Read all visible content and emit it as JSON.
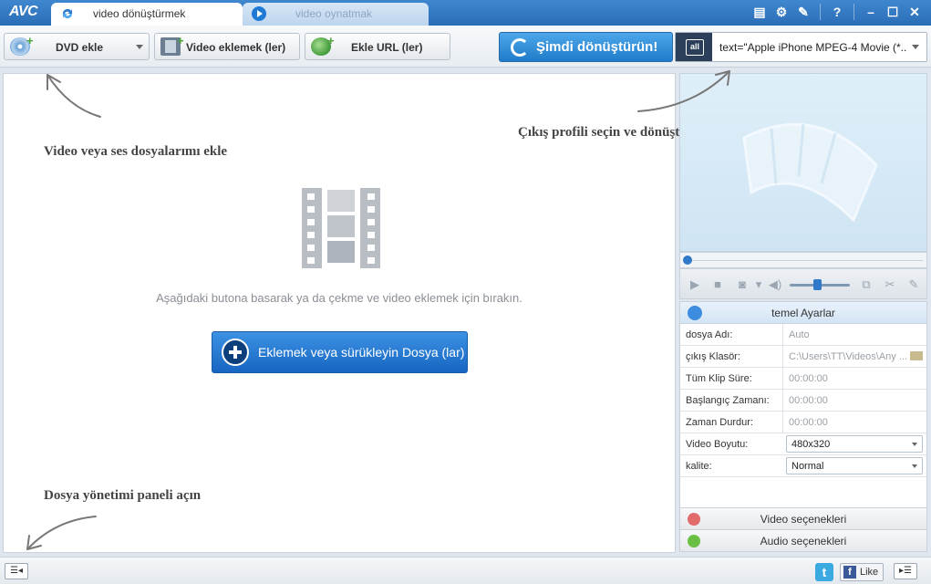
{
  "app": {
    "logo": "AVC"
  },
  "tabs": [
    {
      "label": "video dönüştürmek",
      "active": true
    },
    {
      "label": "video oynatmak",
      "active": false
    }
  ],
  "window_buttons": [
    "list-icon",
    "gear-icon",
    "wrench-icon",
    "help-icon",
    "minimize-icon",
    "maximize-icon",
    "close-icon"
  ],
  "toolbar": {
    "dvd_label": "DVD ekle",
    "video_label": "Video eklemek (ler)",
    "url_label": "Ekle URL (ler)",
    "convert_label": "Şimdi dönüştürün!",
    "profile_value": "text=\"Apple iPhone MPEG-4 Movie (*..."
  },
  "hints": {
    "add_files": "Video veya ses dosyalarımı ekle",
    "profile": "Çıkış profili seçin ve dönüştürmek",
    "file_panel": "Dosya yönetimi paneli açın"
  },
  "droparea": {
    "instruction": "Aşağıdaki butona basarak ya da çekme ve video eklemek için bırakın.",
    "add_button": "Eklemek veya sürükleyin Dosya (lar)"
  },
  "settings": {
    "header": "temel Ayarlar",
    "rows": [
      {
        "label": "dosya Adı:",
        "value": "Auto"
      },
      {
        "label": "çıkış Klasör:",
        "value": "C:\\Users\\TT\\Videos\\Any ..."
      },
      {
        "label": "Tüm Klip Süre:",
        "value": "00:00:00"
      },
      {
        "label": "Başlangıç Zamanı:",
        "value": "00:00:00"
      },
      {
        "label": "Zaman Durdur:",
        "value": "00:00:00"
      },
      {
        "label": "Video Boyutu:",
        "value": "480x320"
      },
      {
        "label": "kalite:",
        "value": "Normal"
      }
    ],
    "video_options": "Video seçenekleri",
    "audio_options": "Audio seçenekleri"
  },
  "statusbar": {
    "like_label": "Like"
  },
  "colors": {
    "accent": "#2a6db6",
    "convert": "#1f7cc9",
    "add_button": "#1766c2"
  }
}
